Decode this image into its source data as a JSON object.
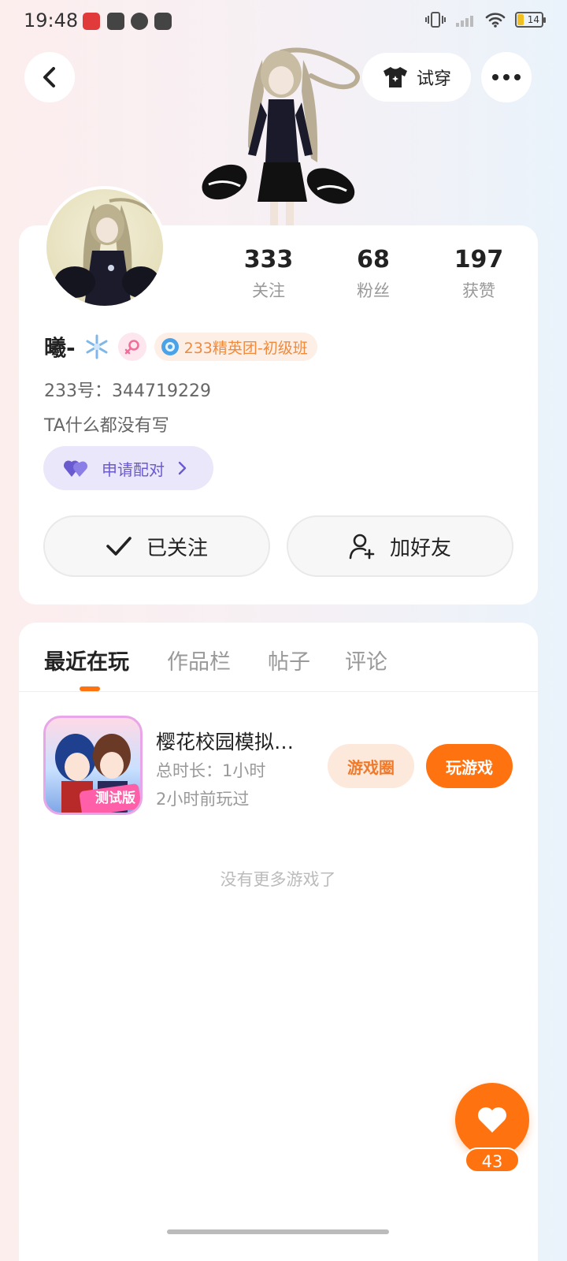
{
  "status_bar": {
    "time": "19:48",
    "battery": "14"
  },
  "header": {
    "tryon_label": "试穿"
  },
  "profile": {
    "stats": [
      {
        "num": "333",
        "label": "关注"
      },
      {
        "num": "68",
        "label": "粉丝"
      },
      {
        "num": "197",
        "label": "获赞"
      }
    ],
    "name": "曦-",
    "badge_label": "233精英团-初级班",
    "id_line": "233号：344719229",
    "bio": "TA什么都没有写",
    "pair_label": "申请配对",
    "followed_label": "已关注",
    "add_friend_label": "加好友"
  },
  "tabs": [
    {
      "label": "最近在玩"
    },
    {
      "label": "作品栏"
    },
    {
      "label": "帖子"
    },
    {
      "label": "评论"
    }
  ],
  "game": {
    "title": "樱花校园模拟…",
    "duration": "总时长：1小时",
    "last_played": "2小时前玩过",
    "icon_tag": "测试版",
    "circle_label": "游戏圈",
    "play_label": "玩游戏"
  },
  "empty_text": "没有更多游戏了",
  "like_count": "43",
  "colors": {
    "accent": "#ff7210",
    "pair": "#6a5ad0",
    "badge": "#f08a3c"
  }
}
